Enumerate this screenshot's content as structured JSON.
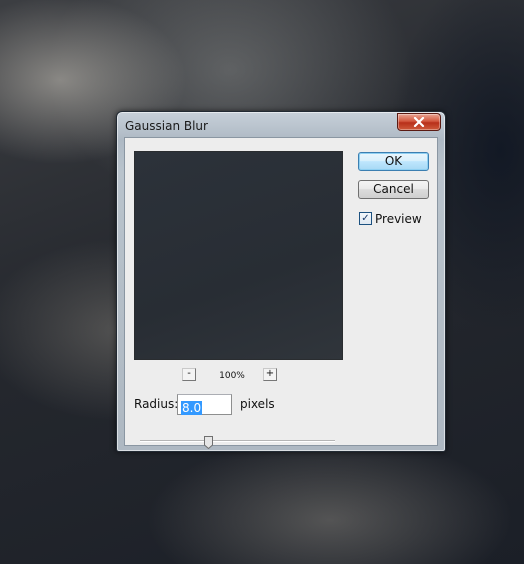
{
  "dialog": {
    "title": "Gaussian Blur",
    "close_icon": "close-icon"
  },
  "buttons": {
    "ok_label": "OK",
    "cancel_label": "Cancel"
  },
  "preview": {
    "label": "Preview",
    "checked": true
  },
  "zoom": {
    "minus_label": "-",
    "level": "100%",
    "plus_label": "+"
  },
  "radius": {
    "label": "Radius:",
    "value": "8.0",
    "unit": "pixels",
    "slider_position": 0.35
  },
  "colors": {
    "accent": "#3399ff",
    "close_button": "#c9412a",
    "default_button_border": "#3c7fb1"
  }
}
